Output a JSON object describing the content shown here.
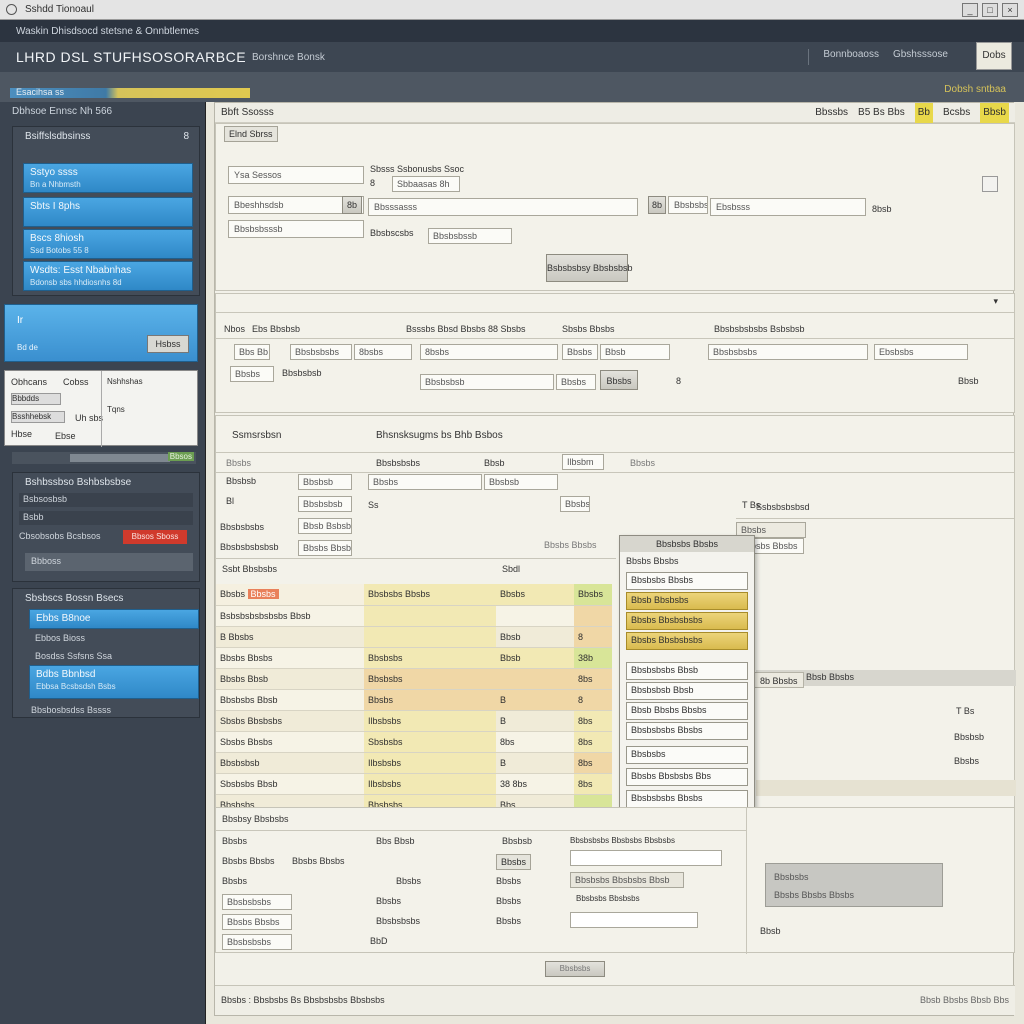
{
  "window": {
    "title": "Sshdd Tionoaul",
    "ctrl_min": "_",
    "ctrl_max": "□",
    "ctrl_close": "×"
  },
  "header1": {
    "text": "Waskin Dhisdsocd stetsne & Onnbtlemes"
  },
  "header2": {
    "brand": "LHRD DSL STUFHSOSORARBCE",
    "nav": "Borshnce Bonsk",
    "nav_right": [
      "Bonnboaoss",
      "Gbshsssose"
    ],
    "help": "Dobs"
  },
  "header3": {
    "strip_label": "Esacihsa ss",
    "right_note": "Dobsh sntbaa"
  },
  "sidebar": {
    "top_label": "Dbhsoe Ennsc Nh 566",
    "panel1_title": "Bsiffslsdbsinss",
    "panel1_count": "8",
    "buttons": [
      {
        "label": "Sstyo ssss",
        "sub": "Bn a Nhbmsth"
      },
      {
        "label": "Sbts I 8phs",
        "sub": ""
      },
      {
        "label": "Bscs 8hiosh",
        "sub": "Ssd Botobs 55 8"
      },
      {
        "label": "Wsdts: Esst Nbabnhas",
        "sub": "Bdonsb sbs hhdiosnhs 8d"
      }
    ],
    "highlight": {
      "label": "Ir",
      "sub": "Bd de",
      "btn": "Hsbss"
    },
    "card": {
      "l1": "Obhcans",
      "r1": "Cobss",
      "l2": "Bbbdds",
      "r2": "Uh sbs",
      "l3": "Bsshhebsk",
      "r3": "Nshhshas",
      "l4": "Tqns",
      "l5": "Hbse",
      "r5": "Ebse"
    },
    "progress_label": "Bbsos",
    "section_label": "Bshbssbso Bshbsbsbse",
    "dark_rows": [
      "Bsbsosbsb",
      "Bsbb"
    ],
    "red_label": "Cbsobsobs Bcsbsos",
    "red_btn": "Bbsos Sboss",
    "gray_row": "Bbboss",
    "section2": "Sbsbscs Bossn Bsecs",
    "buttons2": [
      {
        "label": "Ebbs B8noe",
        "sub": "Ebbos Bioss"
      },
      {
        "label": "Sbbo Bbnas",
        "sub": "Bosdss Ssfsns Ssa"
      },
      {
        "label": "Bdbs Bbnbsd",
        "sub": "Ebbsa Bcsbsdsh Bsbs"
      }
    ],
    "last_row": "Bbsbosbsdss Bssss"
  },
  "main": {
    "strip_left": "Bbft Ssosss",
    "strip_right": [
      "Bbssbs",
      "B5 Bs Bbs",
      "Bb",
      "Bcsbs",
      "Bbsb"
    ],
    "tab_chip": "Elnd Sbrss",
    "form": {
      "field1": "Ysa Sessos",
      "field2_label": "Sbsss Ssbonusbs Ssoc",
      "field2_sub": "8",
      "field2_val": "Sbbaasas 8h",
      "field3": "Bbeshhsdsb",
      "field3_btn": "8b",
      "field4": "Bbsssasss",
      "field5": "Bbsbsbssb",
      "field5_btn": "8b",
      "field5_val": "Ebsbsss",
      "field5_r": "8bsb",
      "field6": "Bbsbsbsssb",
      "field6_sub": "Bbsbscsbs",
      "submit": "Bsbsbsbsy Bbsbsbsb"
    },
    "filter": {
      "labels": [
        "Nbos",
        "Ebs Bbsbsb",
        "Bsssbs Bbsd Bbsbs 88 Sbsbs",
        "Sbsbs Bbsbs",
        "Bbsbsbsbsbs Bsbsbsb"
      ],
      "row1": [
        "Bbs Bb",
        "Bbsbsbsbs",
        "8bsbs",
        "Bbsbs",
        "Ebsbsbs"
      ],
      "row2": [
        "Bbsbs",
        "Bbsbsbsb",
        "Bbsbsbsb",
        "Bbsbs",
        "Bbsb"
      ]
    },
    "section": {
      "title": "Ssmsrsbsn",
      "subtitle": "Bhsnsksugms bs Bhb Bsbos",
      "row1": [
        "Bbsbs",
        "Bbsbsbsbs",
        "Bbsb",
        "Ilbsbm",
        "Bbsbs"
      ],
      "row2": [
        "Bbsbsb",
        "Bbsbs",
        "Bbsbsb"
      ],
      "row3_left": "Bl",
      "row3_input": "Bbsbsbsb",
      "row3_mid": "Ss",
      "row3_right": "Bbsbs",
      "row3_far": "Ssbsbsbsbsd",
      "row4_left": "Bbsbsbsbs",
      "row4_input": "Bbsb Bsbsb",
      "row5_left": "Bbsbsbsbsbsb",
      "row5_input": "Bbsbs Bbsbs",
      "stat_label": "Ssbt Bbsbsbs",
      "stat_mid": "Sbdl"
    },
    "table": {
      "header": [
        "Bbsbs",
        "Bbsbs",
        "Bbsbsbs Bbsbs",
        "Bbsbs",
        "Bbsbs"
      ],
      "rows": [
        [
          "Bsbsbsbsbsbsbs Bbsb",
          "",
          "",
          ""
        ],
        [
          "B Bbsbs",
          "",
          "Bbsb",
          "8"
        ],
        [
          "Bbsbs Bbsbs",
          "Bbsbsbs",
          "Bbsb",
          "38b"
        ],
        [
          "Bbsbs Bbsb",
          "Bbsbsbs",
          "",
          "8bs"
        ],
        [
          "Bbsbsbs Bbsb",
          "Bbsbs",
          "B",
          "8"
        ],
        [
          "Sbsbs Bbsbsbs",
          "Ilbsbsbs",
          "B",
          "8bs"
        ],
        [
          "Sbsbs Bbsbs",
          "Sbsbsbs",
          "8bs",
          "8bs"
        ],
        [
          "Bbsbsbsb",
          "Ilbsbsbs",
          "B",
          "8bs"
        ],
        [
          "Sbsbsbs Bbsb",
          "Ilbsbsbs",
          "38 8bs",
          "8bs"
        ],
        [
          "Bbsbsbs",
          "Bbsbsbs",
          "Bbs",
          ""
        ]
      ]
    },
    "dropdown": {
      "head": "Bbsbsbs Bbsbs",
      "top": "Bbsbs Bbsbs",
      "items": [
        "Bbsbsbs Bbsbs",
        "Bbsb Bbsbsbs",
        "Bbsbs Bbsbsbsbs",
        "Bbsbs Bbsbsbsbs",
        "Bbsbsbsbs Bbsb",
        "Bbsbsbsb Bbsb",
        "Bbsb Bbsbs Bbsbs",
        "Bbsbsbsbs Bbsbs",
        "Bbsbsbs",
        "Bbsbs Bbsbsbs Bbs",
        "Bbsbsbsbs Bbsbs"
      ]
    },
    "right_col": {
      "items": [
        "Bbsbs",
        "Bbsbs Bbsbs",
        "8bsb",
        "Bbsb Bbsbs",
        "8b Bbsbs"
      ],
      "small": [
        "T Bs",
        "Bbsbsb",
        "Bbsbs"
      ]
    },
    "lower": {
      "title": "Bbsbsy Bbsbsbs",
      "rows": [
        [
          "Bbsbs",
          "Bbs Bbsb",
          "Bbsbsb",
          "Bbsbsbsbs Bbsbsbs Bbsbsbs"
        ],
        [
          "Bbsbs Bbsbs",
          "Bbsbs Bbsbs",
          "Bbsbs",
          ""
        ],
        [
          "Bbsbs",
          "Bbsbs",
          "Bbsbs",
          "Bbsbsbs Bbsbsbs Bbsb"
        ],
        [
          "Bbsbsbsbs",
          "Bbsbs",
          "Bbsbs",
          "Bbsbsbs Bbsbsbs"
        ],
        [
          "Bbsbs Bbsbs",
          "Bbsbsbsbs",
          "Bbsbs",
          ""
        ],
        [
          "Bbsbsbsbs",
          "BbD",
          "",
          ""
        ]
      ],
      "gray_box1": "Bbsbsbs",
      "gray_box2": "Bbsbs Bbsbs Bbsbs",
      "btn": "Bbsbsbs",
      "note": "Bbsb"
    },
    "footer": {
      "left": "Bbsbs : Bbsbsbs Bs Bbsbsbsbs Bbsbsbs",
      "right": "Bbsb Bbsbs Bbsb Bbs"
    }
  }
}
